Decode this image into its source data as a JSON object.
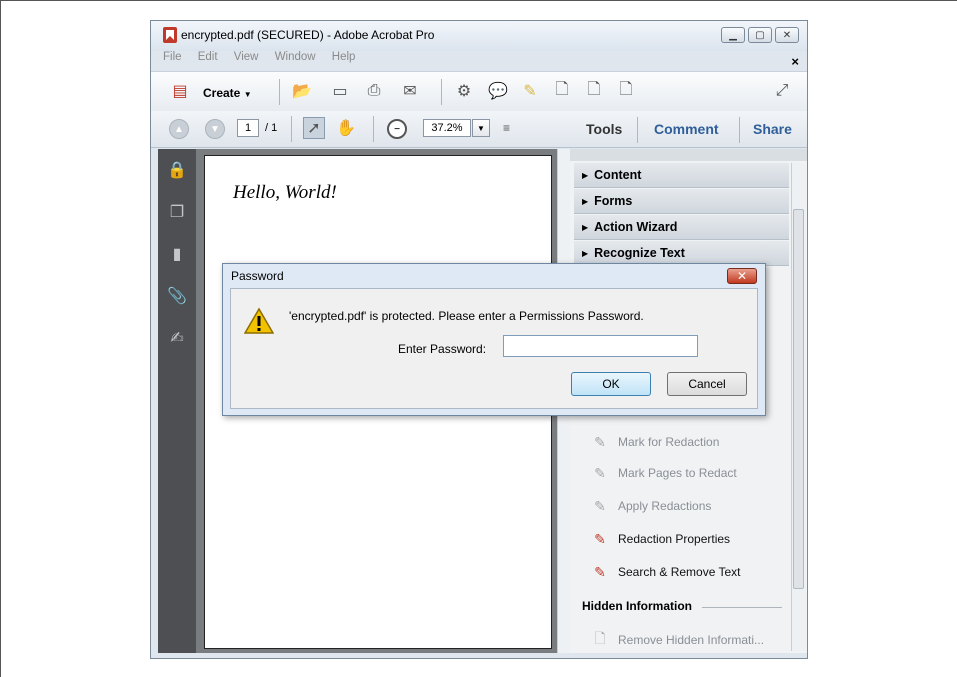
{
  "window": {
    "title": "encrypted.pdf (SECURED) - Adobe Acrobat Pro",
    "menu": [
      "File",
      "Edit",
      "View",
      "Window",
      "Help"
    ]
  },
  "toolbar": {
    "create_label": "Create",
    "page_current": "1",
    "page_total": "/ 1",
    "zoom": "37.2%"
  },
  "pane_tabs": {
    "tools": "Tools",
    "comment": "Comment",
    "share": "Share"
  },
  "document": {
    "text": "Hello, World!"
  },
  "tools_pane": {
    "sections": [
      "Content",
      "Forms",
      "Action Wizard",
      "Recognize Text"
    ],
    "redaction_items": [
      {
        "label": "Mark for Redaction",
        "enabled": false
      },
      {
        "label": "Mark Pages to Redact",
        "enabled": false
      },
      {
        "label": "Apply Redactions",
        "enabled": false
      },
      {
        "label": "Redaction Properties",
        "enabled": true
      },
      {
        "label": "Search & Remove Text",
        "enabled": true
      }
    ],
    "hidden_heading": "Hidden Information",
    "hidden_item": "Remove Hidden Informati..."
  },
  "dialog": {
    "title": "Password",
    "message": "'encrypted.pdf' is protected. Please enter a Permissions Password.",
    "password_label": "Enter Password:",
    "password_value": "",
    "ok_label": "OK",
    "cancel_label": "Cancel"
  }
}
